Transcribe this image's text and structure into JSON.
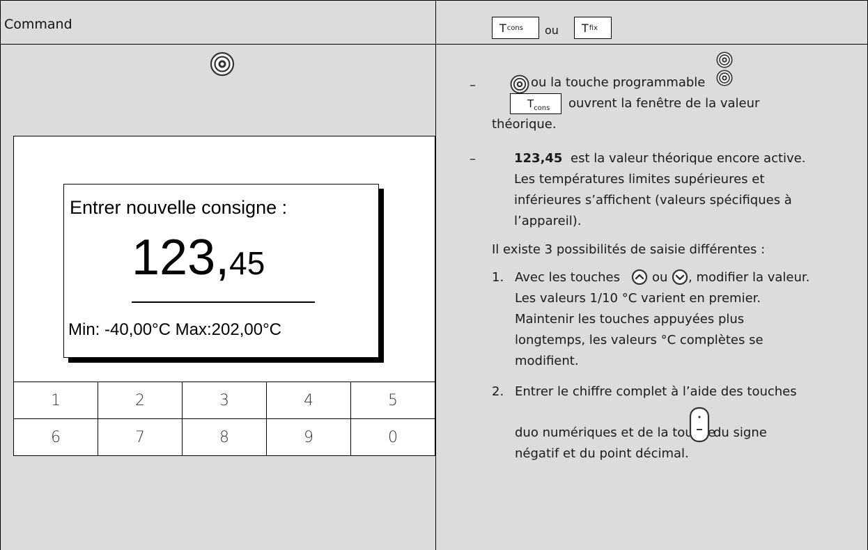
{
  "header": {
    "title": "Command",
    "key1": {
      "main": "T",
      "sub": "cons"
    },
    "or_text": "ou",
    "key2": {
      "main": "T",
      "sub": "fix"
    }
  },
  "left": {
    "icon_top": "dial-icon",
    "dialog": {
      "title": "Entrer nouvelle consigne :",
      "value_int": "123,",
      "value_dec": "45",
      "range": "Min: -40,00°C  Max:202,00°C"
    },
    "keypad": [
      [
        "1",
        "2",
        "3",
        "4",
        "5"
      ],
      [
        "6",
        "7",
        "8",
        "9",
        "0"
      ]
    ]
  },
  "right": {
    "bullet1": {
      "dash": "–",
      "line1_a": "ou la touche programmable",
      "key_main": "T",
      "key_sub": "cons",
      "line2": "ouvrent la fenêtre de la valeur",
      "line3": "théorique."
    },
    "bullet2": {
      "dash": "–",
      "bold": "123,45",
      "line1": "est la valeur théorique encore active.",
      "line2": "Les températures limites supérieures et",
      "line3": "inférieures s’affichent (valeurs spécifiques à",
      "line4": "l’appareil)."
    },
    "intro": "Il existe 3 possibilités de saisie différentes :",
    "item1": {
      "num": "1.",
      "line1_a": "Avec les touches",
      "line1_b": "ou",
      "line1_c": ", modifier la valeur.",
      "line2": "Les valeurs 1/10 °C varient en premier.",
      "line3": "Maintenir les touches appuyées plus",
      "line4": "longtemps, les valeurs °C complètes se",
      "line5": "modifient."
    },
    "item2": {
      "num": "2.",
      "line1": "Entrer le chiffre complet à l’aide des touches",
      "line2_a": "duo numériques et de la touche",
      "line2_b": "du signe",
      "line3": "négatif et du point décimal."
    }
  }
}
